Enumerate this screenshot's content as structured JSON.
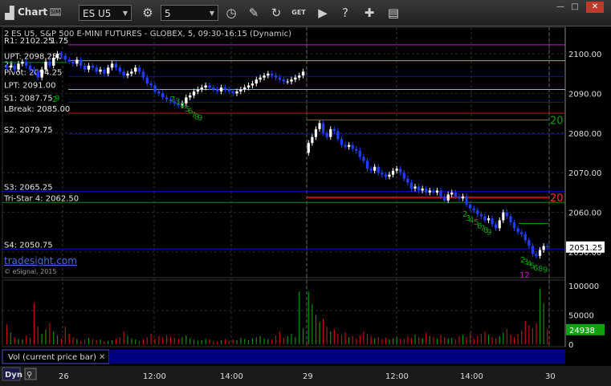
{
  "window": {
    "title": "Chart",
    "badge": "SIM",
    "symbol": "ES U5",
    "interval": "5",
    "badge2": "GET"
  },
  "chart_title": "ES U5, S&P 500 E-MINI FUTURES - GLOBEX, 5, 09:30-16:15 (Dynamic)",
  "chart_title_prefix": "2",
  "watermark": "tradesight.com",
  "copyright": "© eSignal, 2015",
  "colors": {
    "up_candle": "#ffffff",
    "down_candle": "#1f3fff",
    "level_blue": "#1010aa",
    "level_red": "#c01010",
    "level_green": "#0a8a0a",
    "level_cyan": "#40c8ff",
    "level_magenta": "#c020c0",
    "volume_red": "#c01010",
    "volume_green": "#109010",
    "setup_green": "#0aa00a",
    "setup_magenta": "#e000e0"
  },
  "chart_data": {
    "type": "candlestick",
    "y_price_ticks": [
      "2100.00",
      "2090.00",
      "2080.00",
      "2070.00",
      "2060.00",
      "2050.00"
    ],
    "price_ylim": [
      2045,
      2107
    ],
    "current_price": "2051.25",
    "x_ticks": [
      "26",
      "12:00",
      "14:00",
      "29",
      "12:00",
      "14:00",
      "30"
    ],
    "levels": [
      {
        "label": "R1: 2102.25",
        "value": 2102.25,
        "color": "magenta"
      },
      {
        "label": "UPT: 2098.250",
        "value": 2098.25,
        "color": "cyan"
      },
      {
        "label": "Pivot: 2094.25",
        "value": 2094.25,
        "color": "blue"
      },
      {
        "label": "LPT: 2091.00",
        "value": 2091.0,
        "color": "cyan"
      },
      {
        "label": "S1: 2087.75",
        "value": 2087.75,
        "color": "blue"
      },
      {
        "label": "LBreak: 2085.00",
        "value": 2085.0,
        "color": "red"
      },
      {
        "label": "S2: 2079.75",
        "value": 2079.75,
        "color": "blue"
      },
      {
        "label": "S3: 2065.25",
        "value": 2065.25,
        "color": "blue"
      },
      {
        "label": "Tri-Star 4: 2062.50",
        "value": 2062.5,
        "color": "green"
      },
      {
        "label": "S4: 2050.75",
        "value": 2050.75,
        "color": "blue"
      }
    ],
    "r1_overlap_fragment": "1.75",
    "pivot_overlap_fragment": "21",
    "session_levels": [
      {
        "label": "20",
        "value": 2083.3,
        "color": "green"
      },
      {
        "label": "20",
        "value": 2063.8,
        "color": "red"
      }
    ],
    "day1_close": [
      2096.5,
      2097.0,
      2096.0,
      2097.5,
      2098.0,
      2097.0,
      2096.0,
      2095.5,
      2094.0,
      2096.0,
      2098.0,
      2097.0,
      2099.0,
      2100.0,
      2099.5,
      2098.5,
      2098.0,
      2097.5,
      2098.5,
      2097.0,
      2096.0,
      2097.0,
      2096.5,
      2095.5,
      2096.0,
      2095.0,
      2096.5,
      2097.5,
      2096.5,
      2095.5,
      2094.5,
      2095.0,
      2095.5,
      2096.5,
      2095.5,
      2094.0,
      2092.5,
      2092.0,
      2090.5,
      2090.0,
      2089.0,
      2088.5,
      2088.0,
      2087.5,
      2087.0,
      2087.5,
      2089.0,
      2089.5,
      2090.5,
      2091.0,
      2091.5,
      2092.0,
      2091.5,
      2091.0,
      2090.5,
      2091.5,
      2091.0,
      2090.5,
      2090.0,
      2090.5,
      2091.0,
      2091.5,
      2092.0,
      2092.5,
      2093.5,
      2094.0,
      2094.5,
      2095.0,
      2094.5,
      2094.0,
      2093.5,
      2093.0,
      2093.0,
      2093.5,
      2094.0,
      2094.5,
      2095.5
    ],
    "day2_close": [
      2077.5,
      2079.0,
      2081.0,
      2082.5,
      2080.0,
      2079.0,
      2081.0,
      2080.5,
      2078.5,
      2077.0,
      2076.5,
      2077.0,
      2076.0,
      2075.5,
      2074.0,
      2073.0,
      2071.0,
      2070.5,
      2071.5,
      2070.0,
      2069.5,
      2069.0,
      2069.5,
      2070.5,
      2071.0,
      2070.0,
      2068.5,
      2067.5,
      2066.0,
      2066.5,
      2065.5,
      2066.0,
      2065.0,
      2065.5,
      2065.0,
      2065.5,
      2064.0,
      2063.0,
      2064.5,
      2065.0,
      2064.0,
      2063.5,
      2064.0,
      2062.0,
      2061.0,
      2060.5,
      2059.5,
      2059.0,
      2058.0,
      2058.5,
      2057.0,
      2056.0,
      2058.0,
      2060.0,
      2059.0,
      2057.5,
      2056.0,
      2055.0,
      2054.5,
      2053.0,
      2051.5,
      2049.5,
      2049.0,
      2050.5,
      2051.5,
      2051.25
    ],
    "setup_counts_day1": [
      {
        "text": "2",
        "value": 2089.5
      },
      {
        "text": "9",
        "value": 2089.8
      },
      {
        "text": "7",
        "value": 2089.5
      },
      {
        "text": "3",
        "value": 2089.0
      },
      {
        "text": "4",
        "value": 2088.0
      },
      {
        "text": "5",
        "value": 2087.0
      },
      {
        "text": "6",
        "value": 2086.5
      },
      {
        "text": "7",
        "value": 2085.5
      },
      {
        "text": "8",
        "value": 2085.0
      },
      {
        "text": "9",
        "value": 2084.8
      }
    ],
    "setup_counts_day2": [
      {
        "text": "2",
        "value": 2060.5
      },
      {
        "text": "3",
        "value": 2059.5
      },
      {
        "text": "4",
        "value": 2059.0
      },
      {
        "text": "5",
        "value": 2058.5
      },
      {
        "text": "6",
        "value": 2057.5
      },
      {
        "text": "7",
        "value": 2057.0
      },
      {
        "text": "8",
        "value": 2056.5
      },
      {
        "text": "9",
        "value": 2056.0
      },
      {
        "text": "2",
        "value": 2049.0
      },
      {
        "text": "3",
        "value": 2048.5
      },
      {
        "text": "4",
        "value": 2048.0
      },
      {
        "text": "5",
        "value": 2047.5
      },
      {
        "text": "6",
        "value": 2047.0
      },
      {
        "text": "8",
        "value": 2046.8
      },
      {
        "text": "9",
        "value": 2046.5
      }
    ],
    "setup_magenta_label": "12",
    "volume": {
      "label": "Vol (current price bar)",
      "y_ticks": [
        "100000",
        "50000",
        "0"
      ],
      "ylim": [
        0,
        105000
      ],
      "current": "24938",
      "day1": [
        34000,
        20000,
        12000,
        9000,
        8000,
        15000,
        11000,
        70000,
        30000,
        18000,
        25000,
        36000,
        22000,
        15000,
        10000,
        30000,
        18000,
        12000,
        9000,
        6000,
        8000,
        11000,
        9000,
        7000,
        8000,
        5000,
        6000,
        7000,
        9000,
        12000,
        22000,
        14000,
        10000,
        8000,
        6000,
        9000,
        12000,
        18000,
        10000,
        14000,
        12000,
        16000,
        13000,
        11000,
        9000,
        12000,
        15000,
        10000,
        8000,
        6000,
        7000,
        9000,
        8000,
        6000,
        5000,
        7000,
        9000,
        6000,
        8000,
        7000,
        11000,
        9000,
        7000,
        10000,
        12000,
        14000,
        10000,
        9000,
        8000,
        15000,
        22000,
        11000,
        14000,
        18000,
        12000,
        90000,
        27000
      ],
      "day2": [
        90000,
        68000,
        50000,
        38000,
        44000,
        30000,
        22000,
        26000,
        18000,
        16000,
        20000,
        12000,
        14000,
        10000,
        15000,
        22000,
        18000,
        14000,
        10000,
        12000,
        9000,
        11000,
        8000,
        10000,
        12000,
        10000,
        9000,
        14000,
        11000,
        16000,
        12000,
        10000,
        20000,
        14000,
        12000,
        10000,
        16000,
        12000,
        9000,
        11000,
        8000,
        14000,
        16000,
        12000,
        20000,
        10000,
        14000,
        18000,
        22000,
        16000,
        12000,
        10000,
        14000,
        20000,
        26000,
        16000,
        12000,
        18000,
        24000,
        40000,
        32000,
        28000,
        36000,
        95000,
        70000,
        24938
      ]
    }
  },
  "footer": {
    "dyn_label": "Dyn"
  }
}
